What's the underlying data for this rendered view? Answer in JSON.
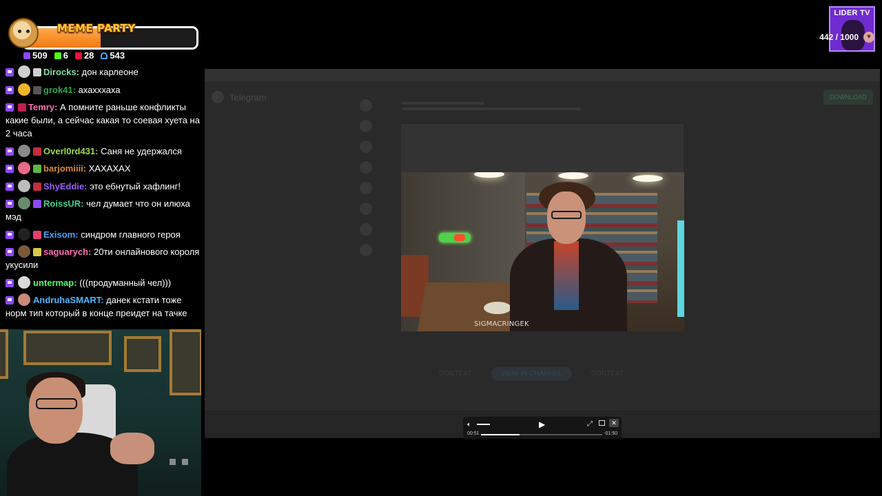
{
  "meme_party": {
    "title": "MEME PARTY",
    "count_text": "442 / 1000",
    "progress": 0.442,
    "fill_color": "#f28c28"
  },
  "stats": [
    {
      "icon": "chat-bubble-icon",
      "value": "509",
      "color": "#9147ff"
    },
    {
      "icon": "kick-icon",
      "value": "6",
      "color": "#53fc18"
    },
    {
      "icon": "live-icon",
      "value": "28",
      "color": "#e9113c"
    },
    {
      "icon": "viewers-icon",
      "value": "543",
      "color": "#4aa3ff"
    }
  ],
  "chat": [
    {
      "user": "Dirocks",
      "color": "#7ee0a5",
      "text": "дон карлеоне",
      "avatar": "#cfcfcf"
    },
    {
      "user": "grok41",
      "color": "#2fa84f",
      "text": "ахахххаха",
      "avatar": "#f0b429"
    },
    {
      "user": "Temry",
      "color": "#ff6eb4",
      "text": "А помните раньше конфликты какие были, а сейчас какая то соевая хуета на 2 часа",
      "avatar": ""
    },
    {
      "user": "Overl0rd431",
      "color": "#9ad94a",
      "text": "Саня не удержался",
      "avatar": "#8a8a8a"
    },
    {
      "user": "barjomiiii",
      "color": "#d98a3a",
      "text": "ХАХАХАХ",
      "avatar": "#e96a8a"
    },
    {
      "user": "ShyEddie",
      "color": "#9a5cff",
      "text": "это ебнутый хафлинг!",
      "avatar": "#bdbdbd"
    },
    {
      "user": "RoissUR",
      "color": "#3ecf8e",
      "text": "чел думает что он илюха мэд",
      "avatar": "#6b8a6b"
    },
    {
      "user": "Exisom",
      "color": "#4aa3ff",
      "text": "синдром главного героя",
      "avatar": "#222222"
    },
    {
      "user": "saguarych",
      "color": "#ff6eb4",
      "text": "20ти онлайнового короля укусили",
      "avatar": "#7a5a3a"
    },
    {
      "user": "untermap",
      "color": "#4dff6a",
      "text": "(((продуманный чел)))",
      "avatar": "#d9d9d9"
    },
    {
      "user": "AndruhaSMART",
      "color": "#4ab8ff",
      "text": "данек кстати тоже норм тип который в конце преидет на тачке",
      "avatar": "#c98a7a"
    }
  ],
  "logo": {
    "text": "LIDER TV",
    "bg": "#6f2bd0"
  },
  "telegram": {
    "title": "Telegram",
    "download_label": "DOWNLOAD",
    "context_label": "CONTEXT",
    "view_label": "VIEW IN CHANNEL",
    "share_label": "CONTEXT"
  },
  "video": {
    "watermark": "SIGMACRINGEK",
    "time_current": "00:51",
    "time_remaining": "-01:50",
    "progress": 0.32,
    "volume": 0.55
  }
}
